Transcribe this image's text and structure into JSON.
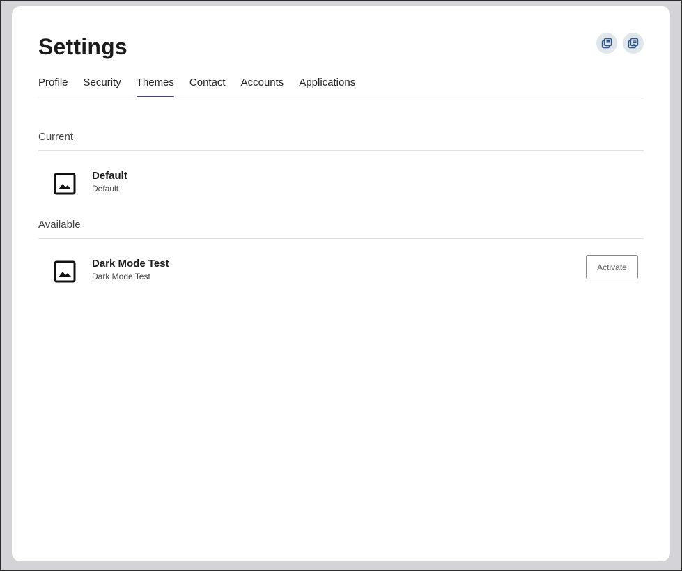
{
  "page": {
    "title": "Settings"
  },
  "header_actions": [
    {
      "icon": "popout-icon"
    },
    {
      "icon": "notes-icon"
    }
  ],
  "tabs": [
    {
      "label": "Profile",
      "active": false
    },
    {
      "label": "Security",
      "active": false
    },
    {
      "label": "Themes",
      "active": true
    },
    {
      "label": "Contact",
      "active": false
    },
    {
      "label": "Accounts",
      "active": false
    },
    {
      "label": "Applications",
      "active": false
    }
  ],
  "sections": {
    "current": {
      "label": "Current",
      "theme": {
        "name": "Default",
        "description": "Default",
        "icon": "image-icon"
      }
    },
    "available": {
      "label": "Available",
      "theme": {
        "name": "Dark Mode Test",
        "description": "Dark Mode Test",
        "icon": "image-icon",
        "action_label": "Activate"
      }
    }
  },
  "colors": {
    "accent": "#464775",
    "background": "#d4d4d8",
    "card": "#ffffff",
    "icon_button_bg": "#dfe6ec"
  }
}
